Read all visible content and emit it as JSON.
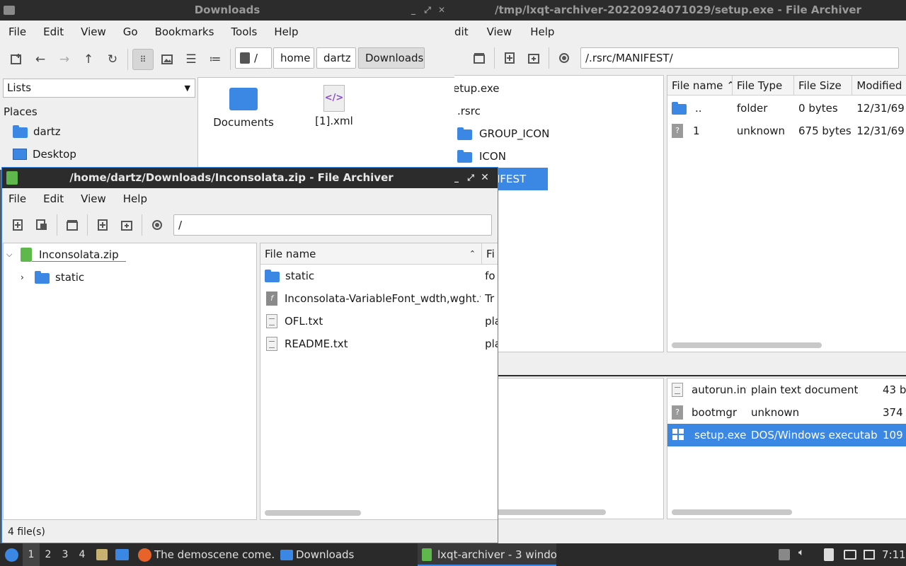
{
  "downloads_window": {
    "title": "Downloads",
    "menu": [
      "File",
      "Edit",
      "View",
      "Go",
      "Bookmarks",
      "Tools",
      "Help"
    ],
    "crumbs": [
      "/",
      "home",
      "dartz",
      "Downloads"
    ],
    "sidebar_mode": "Lists",
    "places_label": "Places",
    "places": [
      "dartz",
      "Desktop"
    ],
    "files": [
      {
        "name": "Documents",
        "icon": "folder-icon"
      },
      {
        "name": "[1].xml",
        "icon": "xml-file-icon"
      }
    ]
  },
  "setup_window": {
    "title": "/tmp/lxqt-archiver-20220924071029/setup.exe - File Archiver",
    "menu": [
      "dit",
      "View",
      "Help"
    ],
    "path": "/.rsrc/MANIFEST/",
    "tree": [
      "etup.exe",
      ".rsrc",
      "GROUP_ICON",
      "ICON",
      "IFEST"
    ],
    "columns": [
      "File name",
      "File Type",
      "File Size",
      "Modified"
    ],
    "top_rows": [
      {
        "name": "..",
        "type": "folder",
        "size": "0 bytes",
        "modified": "12/31/69"
      },
      {
        "name": "1",
        "type": "unknown",
        "size": "675 bytes",
        "modified": "12/31/69"
      }
    ],
    "bottom_rows": [
      {
        "name": "autorun.inf",
        "type": "plain text document",
        "size": "43 b"
      },
      {
        "name": "bootmgr",
        "type": "unknown",
        "size": "374"
      },
      {
        "name": "setup.exe",
        "type": "DOS/Windows executable",
        "size": "109"
      }
    ]
  },
  "inconsolata_window": {
    "title": "/home/dartz/Downloads/Inconsolata.zip - File Archiver",
    "menu": [
      "File",
      "Edit",
      "View",
      "Help"
    ],
    "path": "/",
    "tree": [
      "Inconsolata.zip",
      "static"
    ],
    "columns": [
      "File name",
      "Fi"
    ],
    "files": [
      {
        "name": "static",
        "type": "fo",
        "icon": "folder-icon"
      },
      {
        "name": "Inconsolata-VariableFont_wdth,wght.ttf",
        "type": "Tr",
        "icon": "font-file-icon"
      },
      {
        "name": "OFL.txt",
        "type": "pla",
        "icon": "text-file-icon"
      },
      {
        "name": "README.txt",
        "type": "pla",
        "icon": "text-file-icon"
      }
    ],
    "status": "4 file(s)"
  },
  "taskbar": {
    "desktops": [
      "1",
      "2",
      "3",
      "4"
    ],
    "tasks": [
      "The demoscene come…",
      "Downloads",
      "lxqt-archiver - 3 windo…"
    ],
    "clock": "7:11"
  },
  "colors": {
    "accent": "#3b87e4",
    "titlebar": "#2c2c2c",
    "taskbar": "#2a2a2a"
  }
}
